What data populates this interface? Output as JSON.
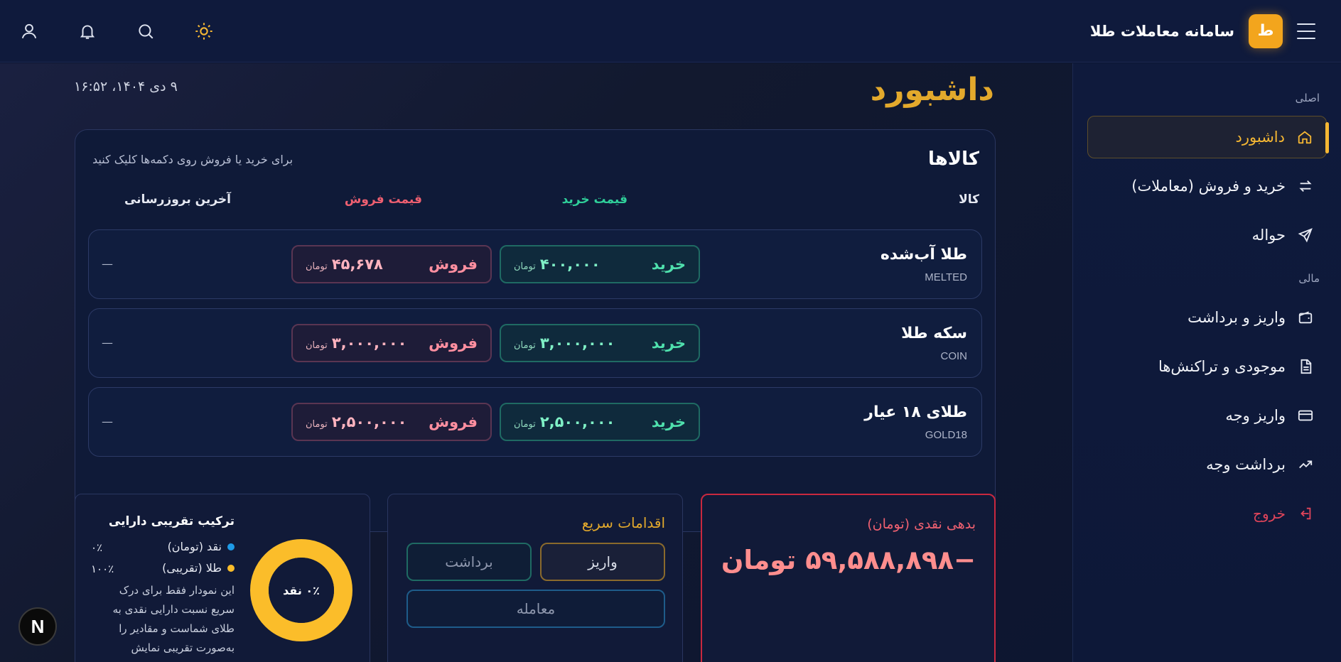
{
  "header": {
    "title": "سامانه معاملات طلا",
    "logo_letter": "ط"
  },
  "sidebar": {
    "section_main": "اصلی",
    "section_finance": "مالی",
    "items": [
      {
        "label": "داشبورد",
        "icon": "home-icon"
      },
      {
        "label": "خرید و فروش (معاملات)",
        "icon": "swap-icon"
      },
      {
        "label": "حواله",
        "icon": "send-icon"
      },
      {
        "label": "واریز و برداشت",
        "icon": "wallet-icon"
      },
      {
        "label": "موجودی و تراکنش‌ها",
        "icon": "document-icon"
      },
      {
        "label": "واریز وجه",
        "icon": "card-icon"
      },
      {
        "label": "برداشت وجه",
        "icon": "trend-up-icon"
      }
    ],
    "logout": "خروج"
  },
  "main": {
    "title": "داشبورد",
    "datetime": "۹ دی ۱۴۰۴، ۱۶:۵۲"
  },
  "goods": {
    "title": "کالاها",
    "hint": "برای خرید یا فروش روی دکمه‌ها کلیک کنید",
    "columns": {
      "goods": "کالا",
      "buy": "قیمت خرید",
      "sell": "قیمت فروش",
      "updated": "آخرین بروزرسانی"
    },
    "buy_label": "خرید",
    "sell_label": "فروش",
    "unit": "تومان",
    "rows": [
      {
        "name": "طلا آب‌شده",
        "code": "MELTED",
        "buy": "۴۰۰,۰۰۰",
        "sell": "۴۵,۶۷۸",
        "updated": "—"
      },
      {
        "name": "سکه طلا",
        "code": "COIN",
        "buy": "۳,۰۰۰,۰۰۰",
        "sell": "۳,۰۰۰,۰۰۰",
        "updated": "—"
      },
      {
        "name": "طلای ۱۸ عیار",
        "code": "GOLD18",
        "buy": "۲,۵۰۰,۰۰۰",
        "sell": "۲,۵۰۰,۰۰۰",
        "updated": "—"
      }
    ]
  },
  "debt": {
    "title": "بدهی نقدی (تومان)",
    "value": "−۵۹,۵۸۸,۸۹۸ تومان"
  },
  "quick": {
    "title": "اقدامات سریع",
    "deposit": "واریز",
    "withdraw": "برداشت",
    "trade": "معامله"
  },
  "composition": {
    "title": "ترکیب تقریبی دارایی",
    "cash_label": "نقد (تومان)",
    "cash_pct": "۰٪",
    "gold_label": "طلا (تقریبی)",
    "gold_pct": "۱۰۰٪",
    "center_label": "۰٪ نقد",
    "note": "این نمودار فقط برای درک سریع نسبت دارایی نقدی به طلای شماست و مقادیر را به‌صورت تقریبی نمایش",
    "cash_fraction": 0,
    "colors": {
      "cash": "#1e9be8",
      "gold": "#fbbd2a"
    }
  },
  "badge": {
    "letter": "N"
  }
}
